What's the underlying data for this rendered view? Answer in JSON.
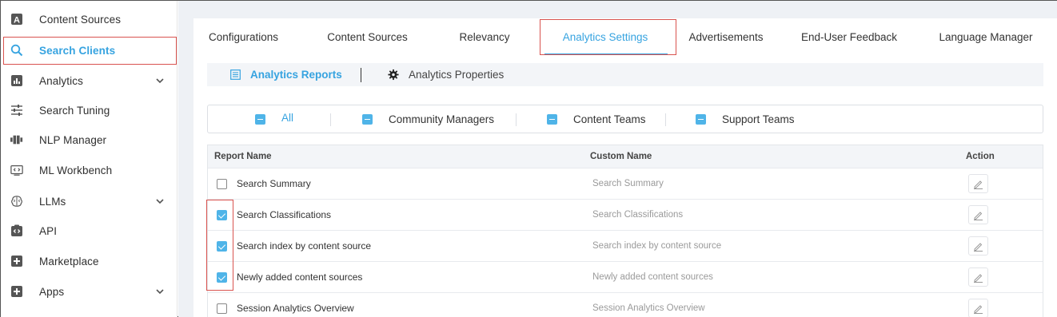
{
  "sidebar": {
    "items": [
      {
        "label": "Content Sources",
        "icon": "letter-a-icon"
      },
      {
        "label": "Search Clients",
        "icon": "search-icon",
        "active": true
      },
      {
        "label": "Analytics",
        "icon": "bar-chart-icon",
        "expandable": true
      },
      {
        "label": "Search Tuning",
        "icon": "sliders-icon"
      },
      {
        "label": "NLP Manager",
        "icon": "nlp-icon"
      },
      {
        "label": "ML Workbench",
        "icon": "code-window-icon"
      },
      {
        "label": "LLMs",
        "icon": "brain-icon",
        "expandable": true
      },
      {
        "label": "API",
        "icon": "api-icon"
      },
      {
        "label": "Marketplace",
        "icon": "plus-square-icon"
      },
      {
        "label": "Apps",
        "icon": "plus-square-icon",
        "expandable": true
      }
    ]
  },
  "tabs": [
    {
      "label": "Configurations"
    },
    {
      "label": "Content Sources"
    },
    {
      "label": "Relevancy"
    },
    {
      "label": "Analytics Settings",
      "active": true
    },
    {
      "label": "Advertisements"
    },
    {
      "label": "End-User Feedback"
    },
    {
      "label": "Language Manager"
    }
  ],
  "subtabs": [
    {
      "label": "Analytics Reports",
      "active": true,
      "icon": "report-list-icon"
    },
    {
      "label": "Analytics Properties",
      "icon": "gear-icon"
    }
  ],
  "filters": [
    {
      "label": "All"
    },
    {
      "label": "Community Managers"
    },
    {
      "label": "Content Teams"
    },
    {
      "label": "Support Teams"
    }
  ],
  "table": {
    "headers": {
      "name": "Report Name",
      "custom": "Custom Name",
      "action": "Action"
    },
    "rows": [
      {
        "name": "Search Summary",
        "custom": "Search Summary",
        "checked": false
      },
      {
        "name": "Search Classifications",
        "custom": "Search Classifications",
        "checked": true
      },
      {
        "name": "Search index by content source",
        "custom": "Search index by content source",
        "checked": true
      },
      {
        "name": "Newly added content sources",
        "custom": "Newly added content sources",
        "checked": true
      },
      {
        "name": "Session Analytics Overview",
        "custom": "Session Analytics Overview",
        "checked": false
      }
    ]
  },
  "colors": {
    "accent": "#36a3e0",
    "highlight_border": "#d9534f"
  }
}
